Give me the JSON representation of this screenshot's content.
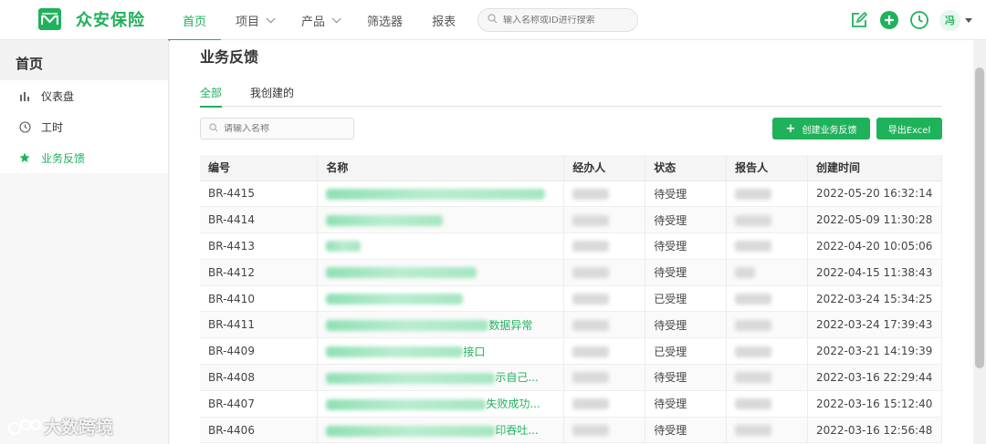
{
  "app": {
    "brand": "众安保险",
    "brand_color": "#1fb25b"
  },
  "nav": {
    "items": [
      {
        "label": "首页",
        "active": true
      },
      {
        "label": "项目",
        "dropdown": true
      },
      {
        "label": "产品",
        "dropdown": true
      },
      {
        "label": "筛选器"
      },
      {
        "label": "报表"
      }
    ],
    "search_placeholder": "输入名称或ID进行搜索"
  },
  "header": {
    "avatar_text": "冯",
    "icons": [
      "edit-icon",
      "add-circle-icon",
      "clock-icon"
    ]
  },
  "sidebar": {
    "title": "首页",
    "items": [
      {
        "label": "仪表盘",
        "icon": "bar-chart-icon"
      },
      {
        "label": "工时",
        "icon": "clock-icon"
      },
      {
        "label": "业务反馈",
        "icon": "star-icon",
        "active": true
      }
    ]
  },
  "page": {
    "title": "业务反馈",
    "tabs": [
      {
        "label": "全部",
        "active": true
      },
      {
        "label": "我创建的"
      }
    ],
    "search_placeholder": "请输入名称",
    "create_button": "创建业务反馈",
    "export_button": "导出Excel"
  },
  "table": {
    "columns": [
      "编号",
      "名称",
      "经办人",
      "状态",
      "报告人",
      "创建时间"
    ],
    "rows": [
      {
        "id": "BR-4415",
        "name_visible": "",
        "status": "待受理",
        "created": "2022-05-20 16:32:14"
      },
      {
        "id": "BR-4414",
        "name_visible": "",
        "status": "待受理",
        "created": "2022-05-09 11:30:28"
      },
      {
        "id": "BR-4413",
        "name_visible": "",
        "status": "待受理",
        "created": "2022-04-20 10:05:06"
      },
      {
        "id": "BR-4412",
        "name_visible": "",
        "status": "待受理",
        "created": "2022-04-15 11:38:43"
      },
      {
        "id": "BR-4410",
        "name_visible": "",
        "status": "已受理",
        "created": "2022-03-24 15:34:25"
      },
      {
        "id": "BR-4411",
        "name_visible": "数据异常",
        "status": "待受理",
        "created": "2022-03-24 17:39:43"
      },
      {
        "id": "BR-4409",
        "name_visible": "接口",
        "status": "已受理",
        "created": "2022-03-21 14:19:39"
      },
      {
        "id": "BR-4408",
        "name_visible": "示自己...",
        "status": "待受理",
        "created": "2022-03-16 22:29:44"
      },
      {
        "id": "BR-4407",
        "name_visible": "失败成功...",
        "status": "待受理",
        "created": "2022-03-16 15:12:40"
      },
      {
        "id": "BR-4406",
        "name_visible": "印吞吐...",
        "status": "待受理",
        "created": "2022-03-16 12:56:48"
      }
    ]
  },
  "watermark": "大数跨境"
}
